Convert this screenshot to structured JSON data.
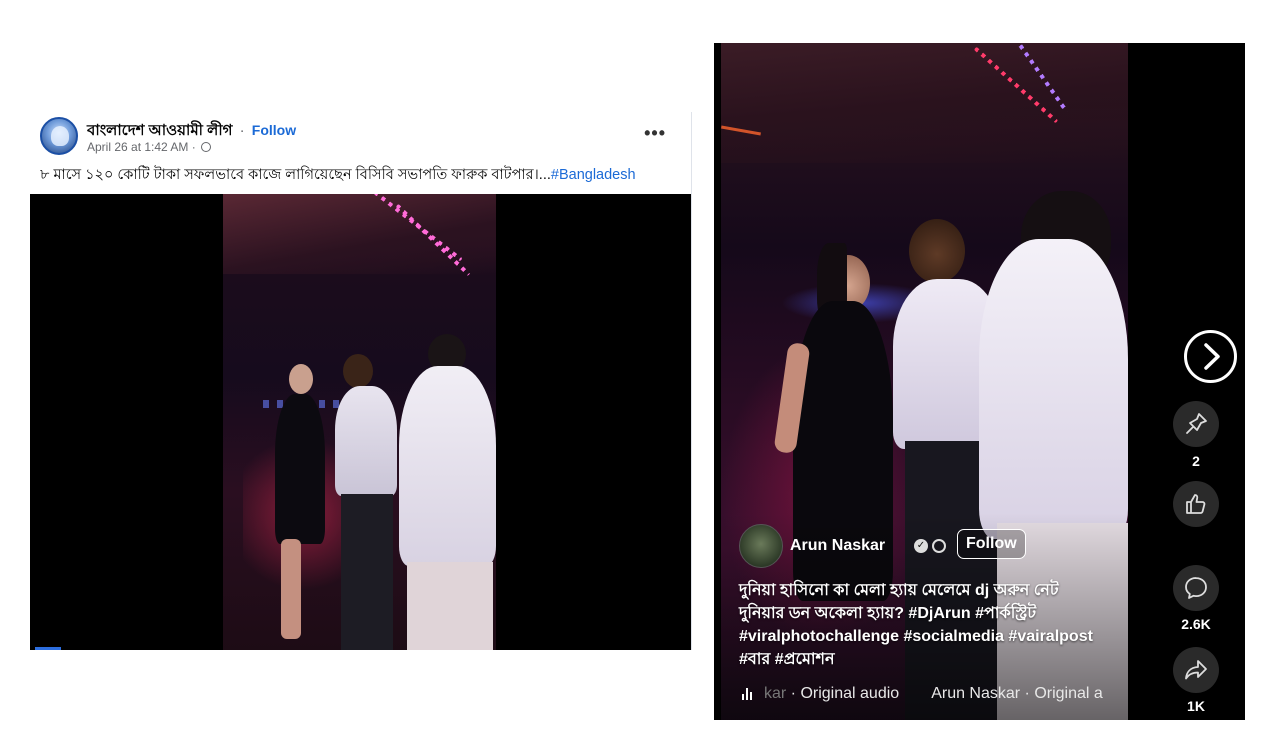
{
  "post": {
    "page_name": "বাংলাদেশ আওয়ামী লীগ",
    "separator": "·",
    "follow_label": "Follow",
    "timestamp": "April 26 at 1:42 AM",
    "meta_separator": "·",
    "more_icon": "more-horizontal-icon",
    "more_label": "•••",
    "caption": "৮ মাসে ১২০ কোটি টাকা সফলভাবে কাজে লাগিয়েছেন বিসিবি সভাপতি ফারুক বাটপার।...",
    "hashtag": "#Bangladesh",
    "accent_color": "#1b6ad6"
  },
  "reel": {
    "author_name": "Arun Naskar",
    "follow_label": "Follow",
    "caption_lines": [
      "দুনিয়া হাসিনো কা মেলা হ্যায় মেলেমে dj অরুন নেট",
      "দুনিয়ার ডন অকেলা হ্যায়? #DjArun #পার্কস্ট্রিট",
      "#viralphotochallenge #socialmedia #vairalpost",
      "#বার #প্রমোশন"
    ],
    "audio_faded": "kar",
    "audio_track": " · Original audio",
    "audio_track_2": "Arun Naskar · Original a",
    "actions": {
      "save_count": "2",
      "like_count": "",
      "comment_count": "2.6K",
      "share_count": "1K"
    }
  }
}
